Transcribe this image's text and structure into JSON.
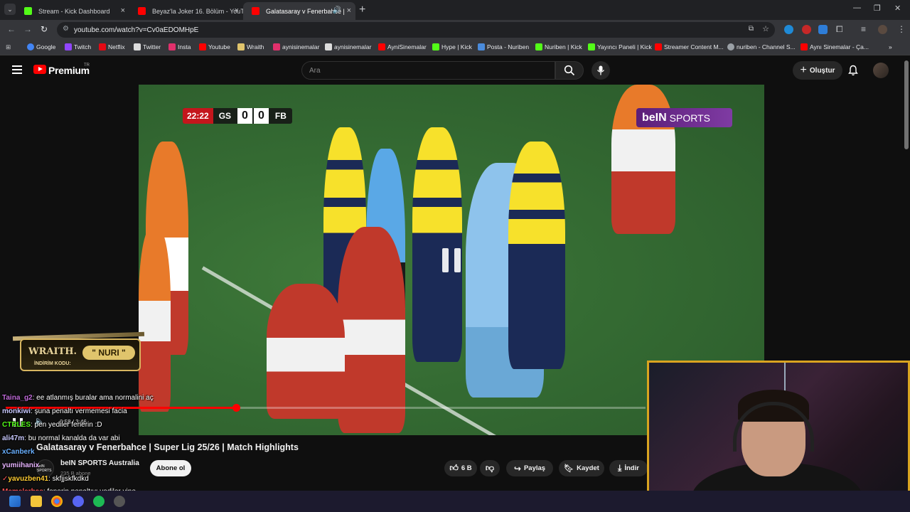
{
  "browser": {
    "tabs": [
      {
        "title": "Stream - Kick Dashboard",
        "favicon_color": "#53fc18"
      },
      {
        "title": "Beyaz'la Joker 16. Bölüm - YouT",
        "favicon_color": "#ff0000"
      },
      {
        "title": "Galatasaray v Fenerbahce |",
        "favicon_color": "#ff0000"
      }
    ],
    "url": "youtube.com/watch?v=Cv0aEDOMHpE",
    "bookmarks": [
      {
        "label": "Google",
        "color": "#4285f4"
      },
      {
        "label": "Twitch",
        "color": "#9146ff"
      },
      {
        "label": "Netflix",
        "color": "#e50914"
      },
      {
        "label": "Twitter",
        "color": "#ffffff"
      },
      {
        "label": "Insta",
        "color": "#e1306c"
      },
      {
        "label": "Youtube",
        "color": "#ff0000"
      },
      {
        "label": "Wraith",
        "color": "#e0c46c"
      },
      {
        "label": "aynisinemalar",
        "color": "#e1306c"
      },
      {
        "label": "aynisinemalar",
        "color": "#ffffff"
      },
      {
        "label": "AyniSinemalar",
        "color": "#ff0000"
      },
      {
        "label": "Hype | Kick",
        "color": "#53fc18"
      },
      {
        "label": "Posta - Nuriben",
        "color": "#4a8bdc"
      },
      {
        "label": "Nuriben | Kick",
        "color": "#53fc18"
      },
      {
        "label": "Yayıncı Paneli | Kick",
        "color": "#53fc18"
      },
      {
        "label": "Streamer Content M...",
        "color": "#ff0000"
      },
      {
        "label": "nuriben - Channel S...",
        "color": "#9aa0a6"
      },
      {
        "label": "Aynı Sinemalar - Ça...",
        "color": "#ff0000"
      }
    ]
  },
  "youtube": {
    "brand": "Premium",
    "country": "TR",
    "search_placeholder": "Ara",
    "create_label": "Oluştur"
  },
  "video": {
    "scorebug": {
      "time": "22:22",
      "home": "GS",
      "home_score": "0",
      "away_score": "0",
      "away": "FB"
    },
    "broadcaster": {
      "name": "beIN",
      "suffix": "SPORTS"
    },
    "time_text": "0:58 / 3:46",
    "progress": 0.36,
    "title": "Galatasaray v Fenerbahce | Super Lig 25/26 | Match Highlights",
    "channel": {
      "name": "beIN SPORTS Australia",
      "subs": "235 B abone",
      "avatar_text": "beIN SPORTS"
    },
    "subscribe_label": "Abone ol",
    "actions": {
      "like": "6 B",
      "share": "Paylaş",
      "save": "Kaydet",
      "download": "İndir"
    }
  },
  "overlay": {
    "wraith": {
      "brand": "WRAITH.",
      "code": "\" NURI \"",
      "label": "İNDİRİM KODU:"
    },
    "chat": [
      {
        "user": "Taina_g2",
        "msg": ": ee atlanmış buralar ama normalini aç",
        "color": "#c06bd9"
      },
      {
        "user": "monkiwi",
        "msg": ": şuna penaltı vermemesi facia",
        "color": "#c9c9ff"
      },
      {
        "user": "CTRLES",
        "msg": ": pen yediler fenerin :D",
        "color": "#53fc18"
      },
      {
        "user": "ali47m",
        "msg": ": bu normal kanalda da var abi",
        "color": "#c9c9ff"
      },
      {
        "user": "xCanberk",
        "msg": "",
        "color": "#6ab0ff"
      },
      {
        "user": "yumiihanix",
        "msg": "",
        "color": "#e8b4ff"
      },
      {
        "user": "yavuzben41",
        "msg": ": skfjjskfkdkd",
        "color": "#ffcc33"
      },
      {
        "user": "Memelerbas",
        "msg": ": fenerin penaltıyı yediler yine",
        "color": "#ff5555"
      }
    ]
  }
}
